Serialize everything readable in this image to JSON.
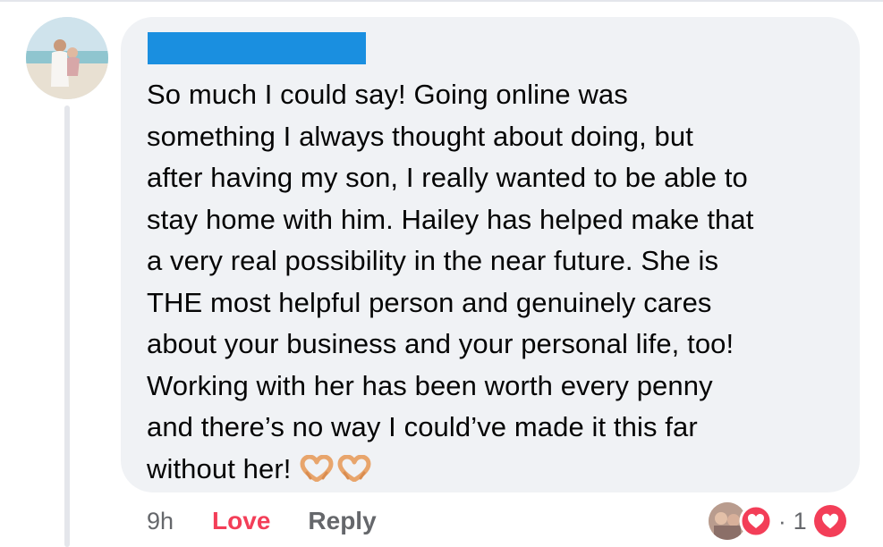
{
  "comment": {
    "text": "So much I could say! Going online was\nsomething I always thought about doing, but\nafter having my son, I really wanted to be able to\nstay home with him. Hailey has helped make that\na very real possibility in the near future. She is\nTHE most helpful person and genuinely cares\nabout your business and your personal life, too!\nWorking with her has been worth every penny\nand there’s no way I could’ve made it this far\nwithout her!",
    "emoji": [
      "heart-hands",
      "heart-hands"
    ]
  },
  "actions": {
    "time": "9h",
    "love_label": "Love",
    "reply_label": "Reply"
  },
  "reactions": {
    "separator": "·",
    "count": "1"
  },
  "colors": {
    "bubble": "#f0f2f5",
    "love": "#f33e58",
    "meta": "#65676b",
    "redaction": "#1a8fe0"
  }
}
